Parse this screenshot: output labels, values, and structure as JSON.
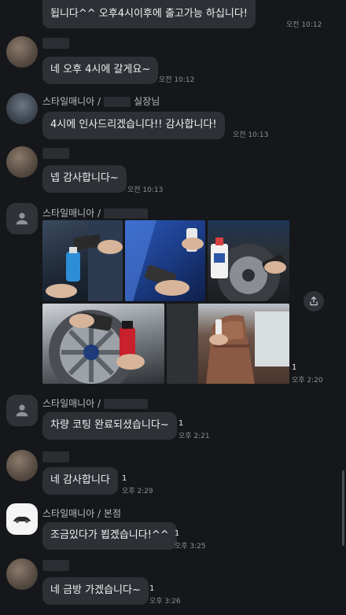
{
  "messages": {
    "top_partial": {
      "text": "됩니다^^ 오후4시이후에 출고가능 하십니다!",
      "time": "오전 10:12"
    },
    "m1": {
      "text": "네 오후 4시에 갈게요~",
      "time": "오전 10:12"
    },
    "m2": {
      "sender_prefix": "스타일매니아 /",
      "sender_suffix": "실장님",
      "text": "4시에 인사드리겠습니다!! 감사합니다!",
      "time": "오전 10:13"
    },
    "m3": {
      "text": "넵 감사합니다~",
      "time": "오전 10:13"
    },
    "m4": {
      "sender_prefix": "스타일매니아 /",
      "unread": "1",
      "time": "오후 2:20"
    },
    "m5": {
      "sender_prefix": "스타일매니아 /",
      "text": "차량 코팅 완료되셨습니다~",
      "unread": "1",
      "time": "오후 2:21"
    },
    "m6": {
      "text": "네 감사합니다",
      "unread": "1",
      "time": "오후 2:29"
    },
    "m7": {
      "sender": "스타일매니아 / 본점",
      "text": "조금있다가 뵙겠습니다!^^",
      "unread": "1",
      "time": "오후 3:25"
    },
    "m8": {
      "text": "네 금방 가겠습니다~",
      "unread": "1",
      "time": "오후 3:26"
    }
  },
  "icons": {
    "share": "share-icon",
    "profile": "person-icon"
  },
  "colors": {
    "background": "#15171a",
    "bubble": "#2d3035",
    "time": "#8c9096"
  }
}
